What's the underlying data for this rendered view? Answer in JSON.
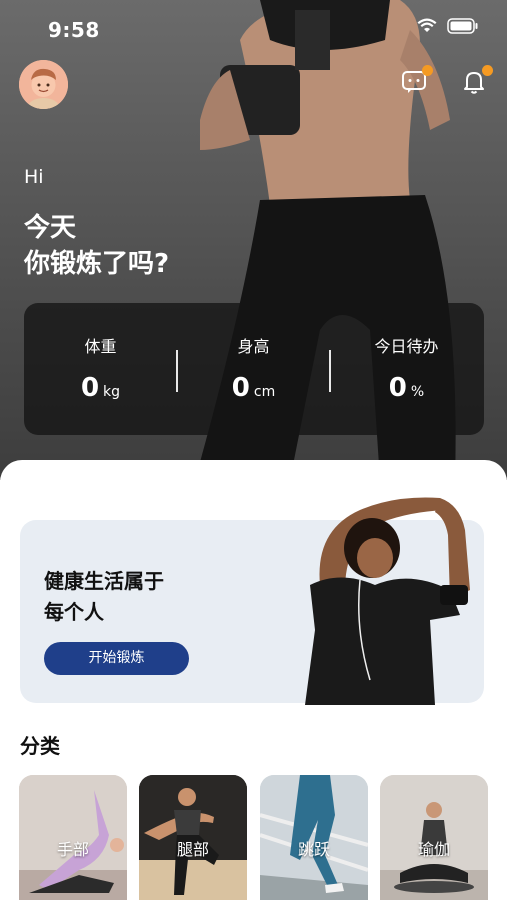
{
  "status_bar": {
    "time": "9:58"
  },
  "header": {
    "greeting": "Hi",
    "headline_line1": "今天",
    "headline_line2": "你锻炼了吗?"
  },
  "stats": [
    {
      "label": "体重",
      "value": "0",
      "unit": "kg"
    },
    {
      "label": "身高",
      "value": "0",
      "unit": "cm"
    },
    {
      "label": "今日待办",
      "value": "0",
      "unit": "%"
    }
  ],
  "banner": {
    "title_line1": "健康生活属于",
    "title_line2": "每个人",
    "button_label": "开始锻炼"
  },
  "categories": {
    "title": "分类",
    "items": [
      {
        "label": "手部"
      },
      {
        "label": "腿部"
      },
      {
        "label": "跳跃"
      },
      {
        "label": "瑜伽"
      }
    ]
  },
  "colors": {
    "accent": "#1f3f8a",
    "badge": "#f59a23",
    "banner_bg": "#e8edf3"
  }
}
